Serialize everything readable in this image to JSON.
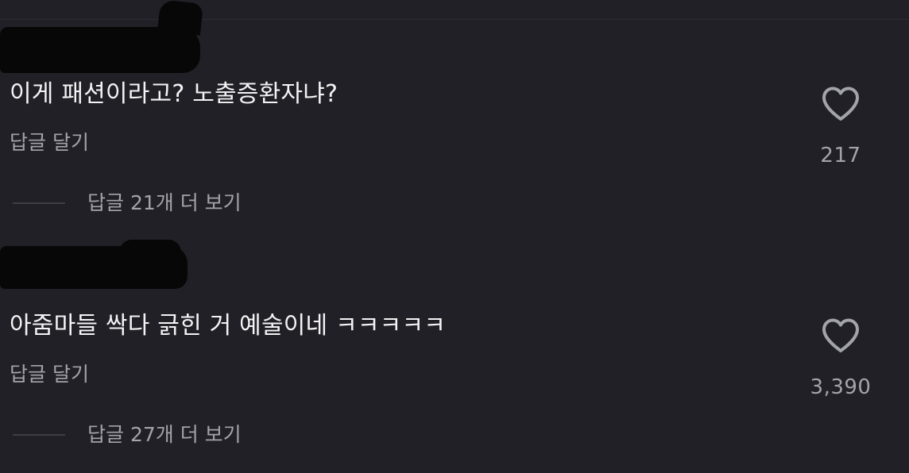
{
  "comments": [
    {
      "text": "이게 패션이라고? 노출증환자냐?",
      "reply_label": "답글 달기",
      "view_replies_label": "답글 21개 더 보기",
      "like_icon": "heart-outline",
      "like_count": "217"
    },
    {
      "text": "아줌마들 싹다 긁힌 거 예술이네 ㅋㅋㅋㅋㅋ",
      "reply_label": "답글 달기",
      "view_replies_label": "답글 27개 더 보기",
      "like_icon": "heart-outline",
      "like_count": "3,390"
    }
  ],
  "colors": {
    "background": "#202026",
    "text_primary": "#f4f4f6",
    "text_secondary": "#a3a3aa",
    "redaction": "#070708"
  }
}
